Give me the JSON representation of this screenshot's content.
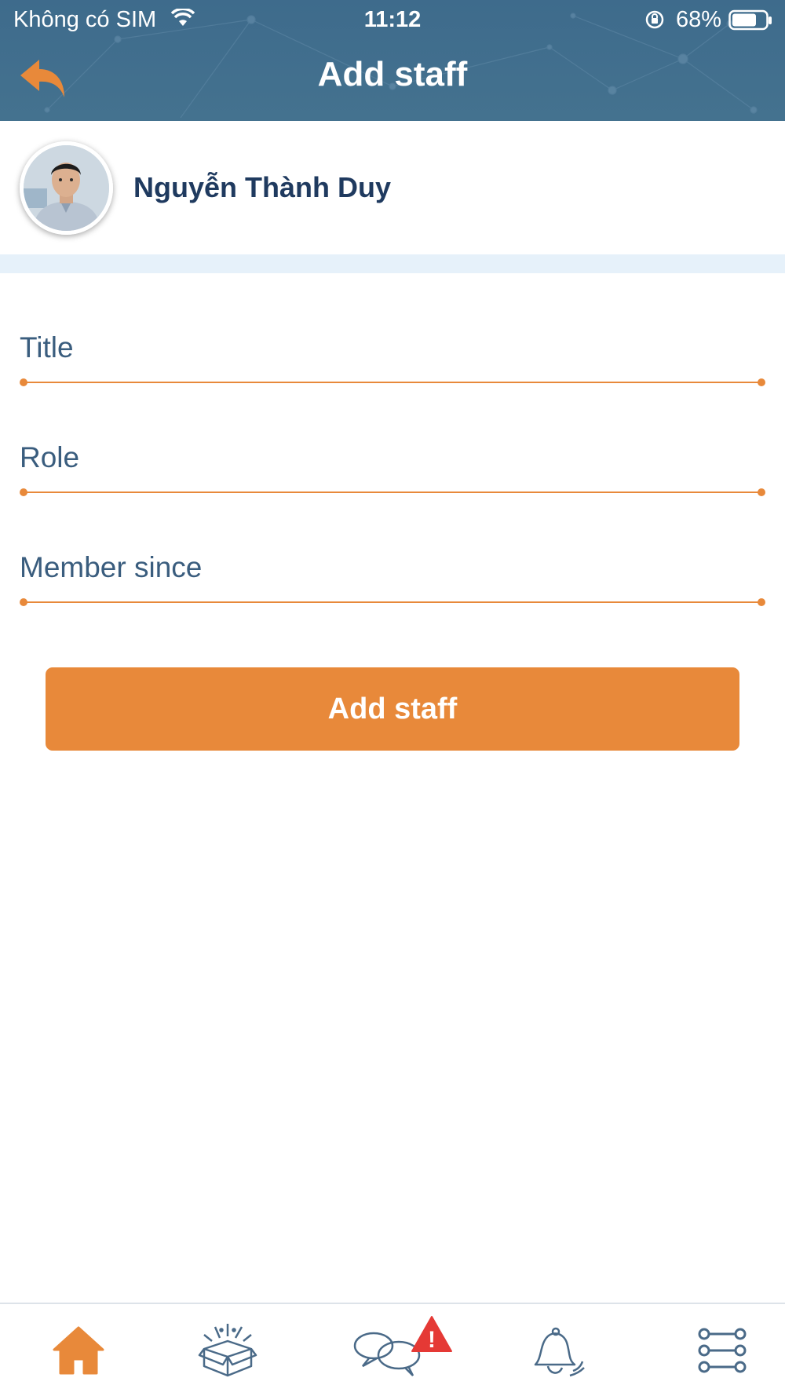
{
  "status_bar": {
    "carrier": "Không có SIM",
    "time": "11:12",
    "battery": "68%"
  },
  "header": {
    "title": "Add staff",
    "back_icon": "back-arrow-icon"
  },
  "profile": {
    "name": "Nguyễn Thành Duy"
  },
  "form": {
    "title_placeholder": "Title",
    "role_placeholder": "Role",
    "member_since_placeholder": "Member since",
    "title_value": "",
    "role_value": "",
    "member_since_value": ""
  },
  "submit_label": "Add staff",
  "tabbar": {
    "items": [
      {
        "icon": "home-icon",
        "active": true
      },
      {
        "icon": "gift-box-icon",
        "active": false
      },
      {
        "icon": "chat-icon",
        "active": false,
        "alert": "!"
      },
      {
        "icon": "notification-bell-icon",
        "active": false
      },
      {
        "icon": "settings-sliders-icon",
        "active": false
      }
    ]
  },
  "colors": {
    "header": "#44728f",
    "accent": "#e8893a",
    "text_dark": "#1f3a5f",
    "text_field": "#3a5d7e",
    "divider": "#e6f1fa",
    "alert": "#e53935",
    "icon_inactive": "#4a6a88"
  }
}
